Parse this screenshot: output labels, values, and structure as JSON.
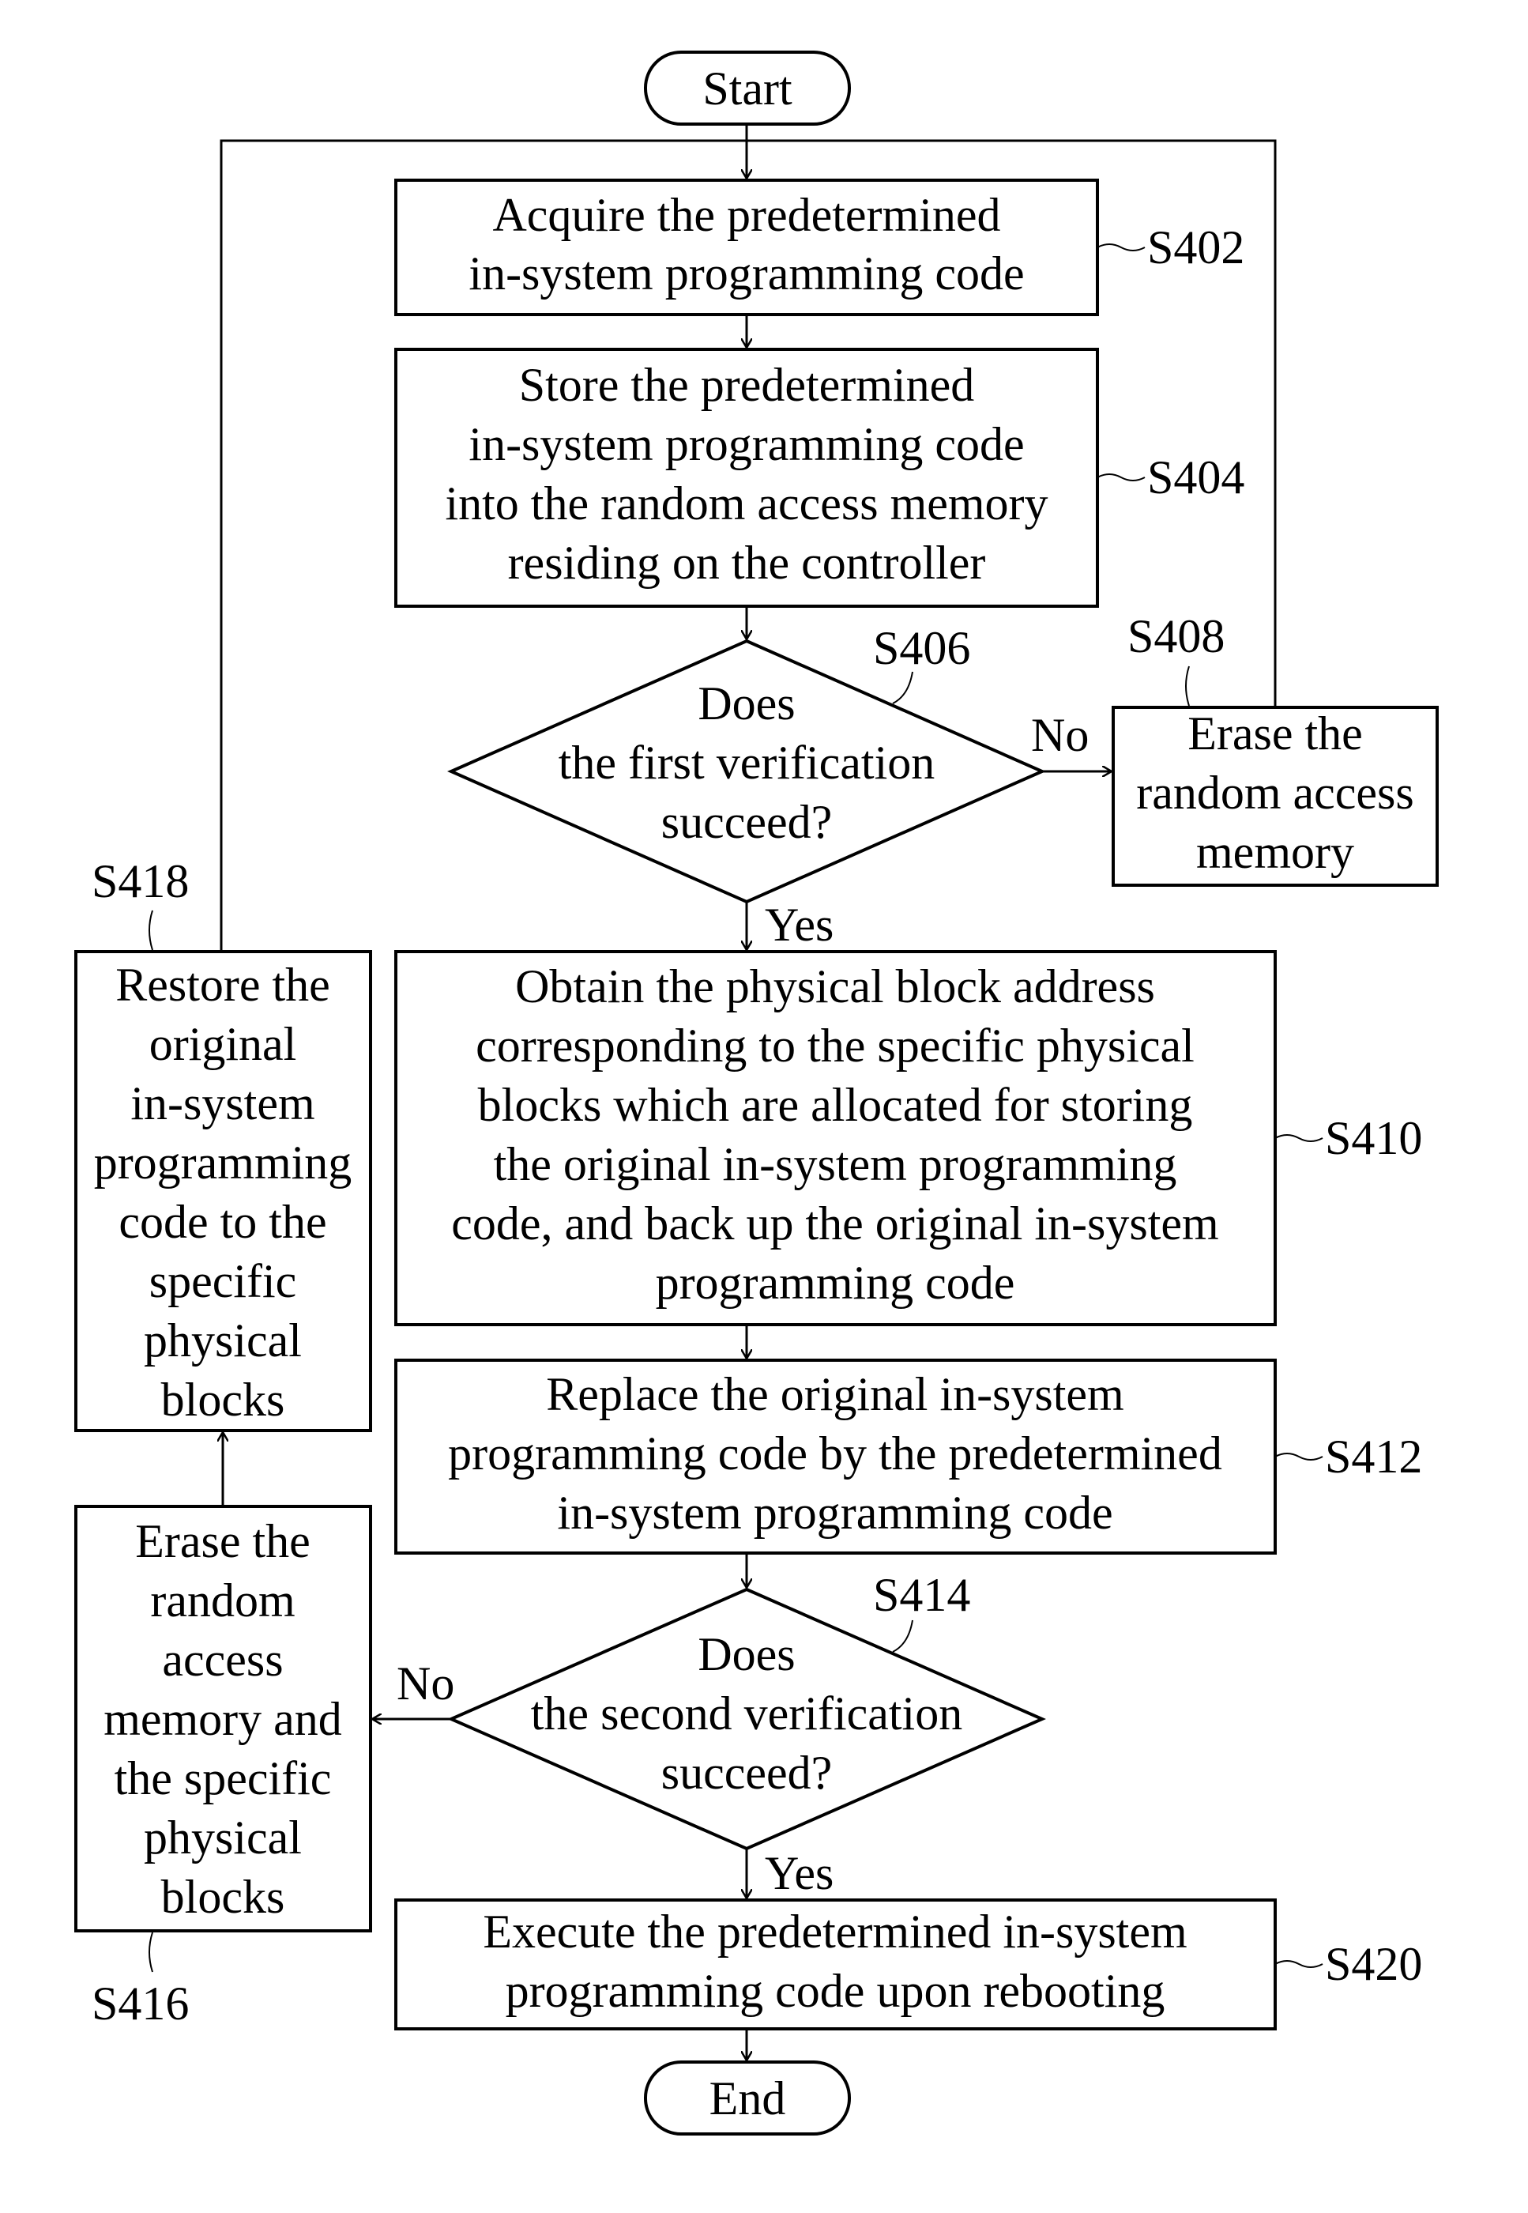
{
  "terminals": {
    "start": "Start",
    "end": "End"
  },
  "steps": {
    "s402": {
      "id": "S402",
      "lines": [
        "Acquire the predetermined",
        "in-system programming code"
      ]
    },
    "s404": {
      "id": "S404",
      "lines": [
        "Store the predetermined",
        "in-system programming code",
        "into the random access memory",
        "residing on the controller"
      ]
    },
    "s406": {
      "id": "S406",
      "lines": [
        "Does",
        "the first verification",
        "succeed?"
      ]
    },
    "s408": {
      "id": "S408",
      "lines": [
        "Erase the",
        "random access",
        "memory"
      ]
    },
    "s410": {
      "id": "S410",
      "lines": [
        "Obtain the physical block address",
        "corresponding to the specific physical",
        "blocks which are allocated for storing",
        "the original in-system programming",
        "code, and back up the original in-system",
        "programming code"
      ]
    },
    "s412": {
      "id": "S412",
      "lines": [
        "Replace the original in-system",
        "programming code by the predetermined",
        "in-system programming code"
      ]
    },
    "s414": {
      "id": "S414",
      "lines": [
        "Does",
        "the second verification",
        "succeed?"
      ]
    },
    "s416": {
      "id": "S416",
      "lines": [
        "Erase the",
        "random",
        "access",
        "memory and",
        "the specific",
        "physical",
        "blocks"
      ]
    },
    "s418": {
      "id": "S418",
      "lines": [
        "Restore the",
        "original",
        "in-system",
        "programming",
        "code to the",
        "specific",
        "physical",
        "blocks"
      ]
    },
    "s420": {
      "id": "S420",
      "lines": [
        "Execute the predetermined in-system",
        "programming code upon rebooting"
      ]
    }
  },
  "edge_labels": {
    "s406_no": "No",
    "s406_yes": "Yes",
    "s414_no": "No",
    "s414_yes": "Yes"
  }
}
